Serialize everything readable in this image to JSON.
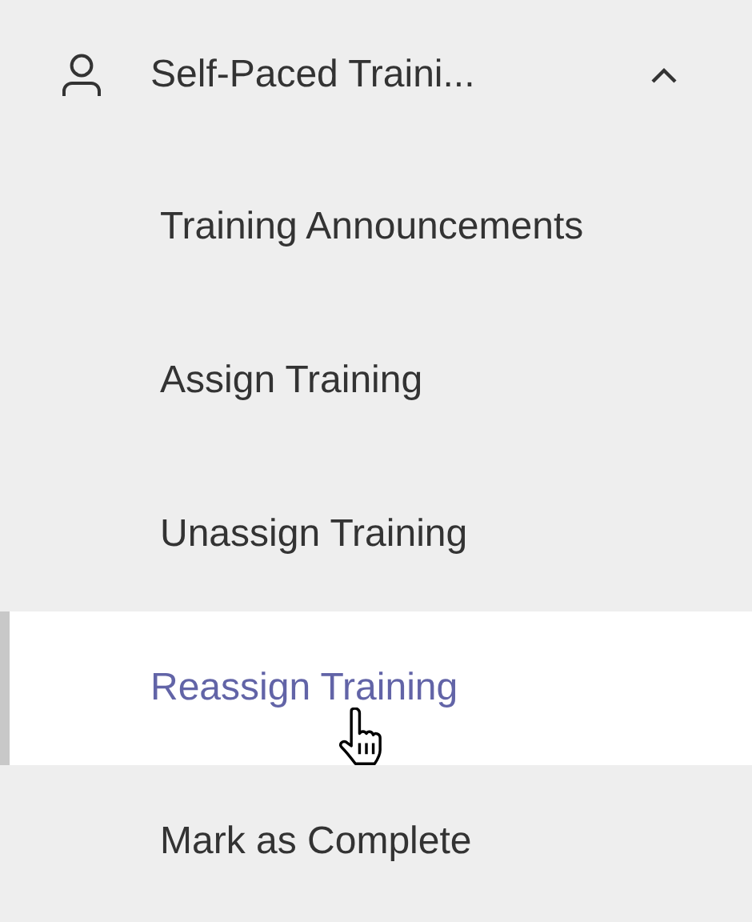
{
  "group": {
    "title": "Self-Paced Traini...",
    "expanded": true
  },
  "items": [
    {
      "label": "Training Announcements",
      "selected": false
    },
    {
      "label": "Assign Training",
      "selected": false
    },
    {
      "label": "Unassign Training",
      "selected": false
    },
    {
      "label": "Reassign Training",
      "selected": true
    },
    {
      "label": "Mark as Complete",
      "selected": false
    }
  ]
}
